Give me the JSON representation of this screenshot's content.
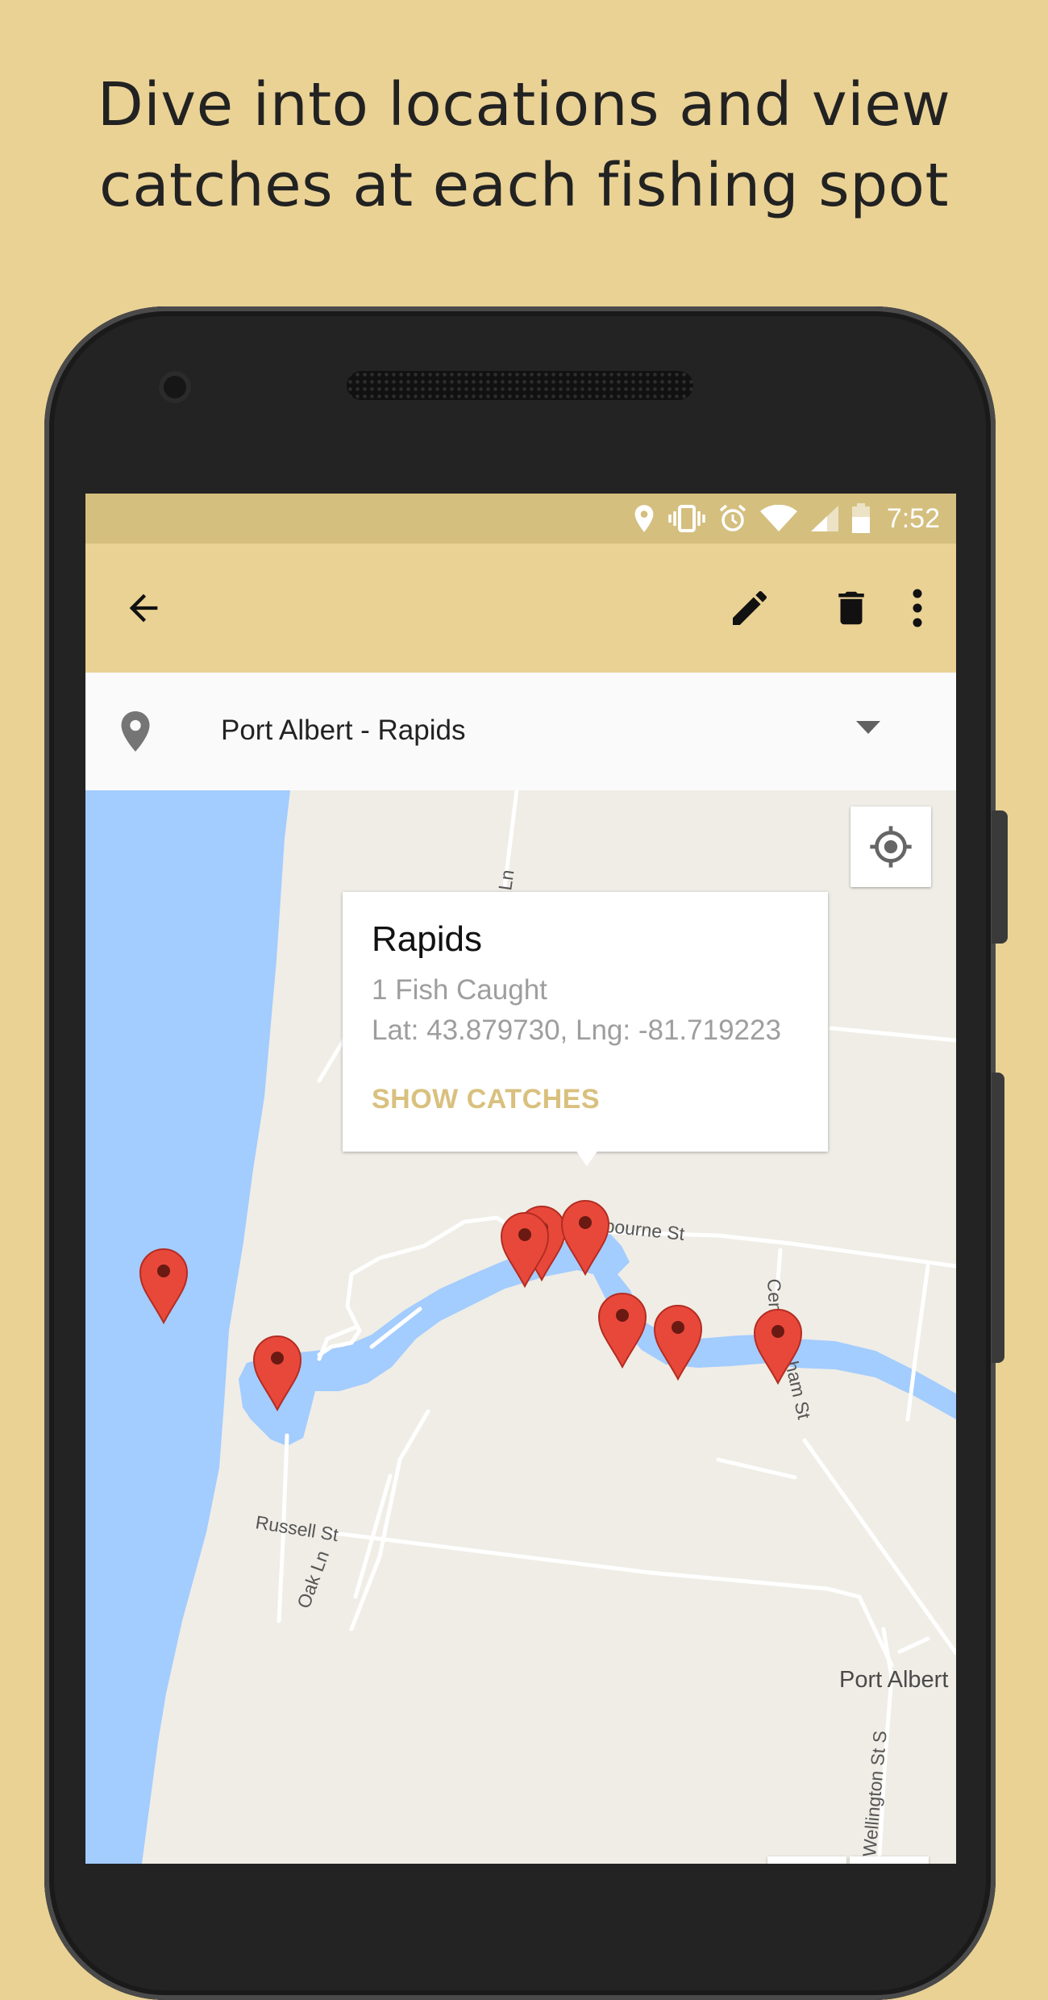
{
  "headline": {
    "line1": "Dive into locations and view",
    "line2": "catches at each fishing spot"
  },
  "status_bar": {
    "time": "7:52",
    "icons": [
      "location-pin-icon",
      "vibrate-icon",
      "alarm-icon",
      "wifi-icon",
      "signal-icon",
      "battery-icon"
    ]
  },
  "app_bar": {
    "back_icon": "arrow-back-icon",
    "edit_icon": "pencil-icon",
    "delete_icon": "trash-icon",
    "more_icon": "more-vert-icon",
    "accent_color": "#EAD295"
  },
  "location_selector": {
    "selected": "Port Albert - Rapids"
  },
  "map": {
    "street_labels": [
      "Ln",
      "lbourne St",
      "Centra",
      "ham St",
      "Russell St",
      "Oak Ln",
      "Port Albert",
      "Wellington St S"
    ],
    "info_window": {
      "title": "Rapids",
      "fish_caught": "1 Fish Caught",
      "coordinates": "Lat: 43.879730, Lng: -81.719223",
      "action": "SHOW CATCHES"
    },
    "marker_color": "#E8483A",
    "water_color": "#A3CCFF",
    "land_color": "#EFEDE6"
  }
}
